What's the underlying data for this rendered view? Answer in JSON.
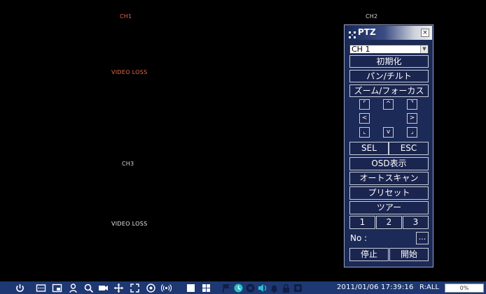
{
  "channels": {
    "ch1": "CH1",
    "ch2": "CH2",
    "ch3": "CH3",
    "video_loss_1": "VIDEO LOSS",
    "video_loss_3": "VIDEO LOSS"
  },
  "ptz": {
    "title": "PTZ",
    "close": "×",
    "channel_select": "CH 1",
    "init": "初期化",
    "pan_tilt": "パン/チルト",
    "zoom_focus": "ズーム/フォーカス",
    "dir_up_left": "⌜",
    "dir_up": "^",
    "dir_up_right": "⌝",
    "dir_left": "<",
    "dir_right": ">",
    "dir_down_left": "⌞",
    "dir_down": "v",
    "dir_down_right": "⌟",
    "sel": "SEL",
    "esc": "ESC",
    "osd": "OSD表示",
    "autoscan": "オートスキャン",
    "preset": "プリセット",
    "tour": "ツアー",
    "n1": "1",
    "n2": "2",
    "n3": "3",
    "no_label": "No :",
    "more": "...",
    "stop": "停止",
    "start": "開始"
  },
  "taskbar": {
    "datetime": "2011/01/06 17:39:16",
    "record_mode": "R:ALL",
    "hdd": "0%",
    "icons": [
      "power-icon",
      "menu-icon",
      "display-icon",
      "search-person-icon",
      "search-icon",
      "camera-icon",
      "move-icon",
      "zoom-icon",
      "focus-icon",
      "wireless-icon",
      "single-view-icon",
      "quad-view-icon",
      "flag-icon",
      "clock-icon",
      "record-icon",
      "speaker-icon",
      "alarm-icon",
      "lock-icon",
      "network-icon"
    ]
  }
}
